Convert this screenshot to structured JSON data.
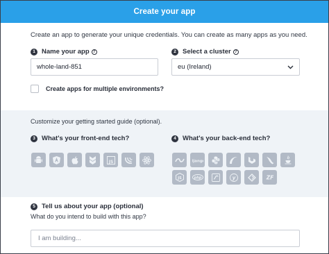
{
  "header": {
    "title": "Create your app"
  },
  "intro": "Create an app to generate your unique credentials. You can create as many apps as you need.",
  "step1": {
    "num": "1",
    "label": "Name your app",
    "help": "?",
    "value": "whole-land-851"
  },
  "step2": {
    "num": "2",
    "label": "Select a cluster",
    "help": "?",
    "value": "eu (Ireland)",
    "chevron": "⌄"
  },
  "checkbox": {
    "label": "Create apps for multiple environments?",
    "checked": false
  },
  "guide": "Customize your getting started guide (optional).",
  "step3": {
    "num": "3",
    "label": "What's your front-end tech?",
    "icons": [
      "android-icon",
      "angular-icon",
      "apple-icon",
      "backbone-icon",
      "javascript-icon",
      "jquery-icon",
      "react-icon"
    ]
  },
  "step4": {
    "num": "4",
    "label": "What's your back-end tech?",
    "icons_row1": [
      "dotnet-icon",
      "django-icon",
      "python-icon",
      "rails-icon",
      "laravel-icon",
      "flask-icon",
      "java-icon"
    ],
    "icons_row2": [
      "nodejs-icon",
      "php-icon",
      "symfony-icon",
      "yii-icon",
      "go-icon",
      "zend-icon"
    ]
  },
  "step5": {
    "num": "5",
    "label": "Tell us about your app (optional)",
    "question": "What do you intend to build with this app?",
    "placeholder": "I am building..."
  },
  "colors": {
    "header": "#2aa0e8",
    "tech_icon": "#b2bac6",
    "grey_section": "#eff3f7"
  }
}
